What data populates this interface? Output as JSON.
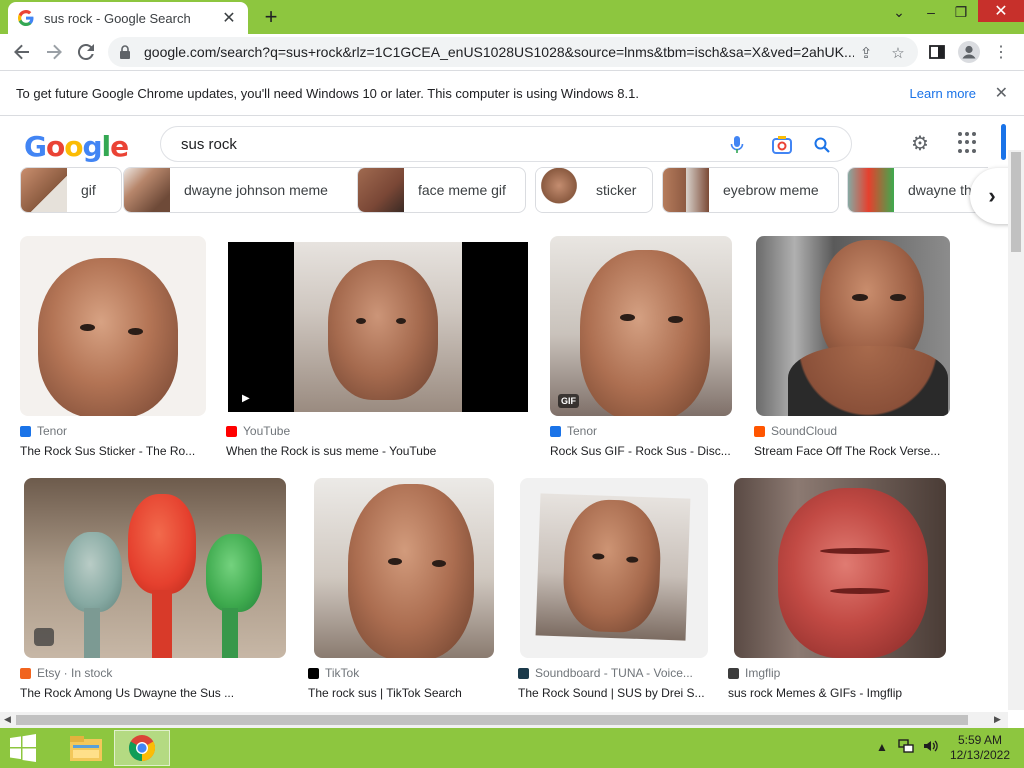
{
  "browser": {
    "tab_title": "sus rock - Google Search",
    "url": "google.com/search?q=sus+rock&rlz=1C1GCEA_enUS1028US1028&source=lnms&tbm=isch&sa=X&ved=2ahUK...",
    "favicon_letter": "G"
  },
  "infobar": {
    "message": "To get future Google Chrome updates, you'll need Windows 10 or later. This computer is using Windows 8.1.",
    "learn_more": "Learn more"
  },
  "search": {
    "query": "sus rock"
  },
  "chips": [
    {
      "label": "gif"
    },
    {
      "label": "dwayne johnson meme"
    },
    {
      "label": "face meme gif"
    },
    {
      "label": "sticker"
    },
    {
      "label": "eyebrow meme"
    },
    {
      "label": "dwayne th"
    }
  ],
  "results": [
    {
      "source": "Tenor",
      "title": "The Rock Sus Sticker - The Ro...",
      "source_color": "#1a73e8"
    },
    {
      "source": "YouTube",
      "title": "When the Rock is sus meme - YouTube",
      "source_color": "#ff0000"
    },
    {
      "source": "Tenor",
      "title": "Rock Sus GIF - Rock Sus - Disc...",
      "source_color": "#1a73e8",
      "badge": "GIF"
    },
    {
      "source": "SoundCloud",
      "title": "Stream Face Off The Rock Verse...",
      "source_color": "#ff5500"
    },
    {
      "source": "Etsy · In stock",
      "title": "The Rock Among Us Dwayne the Sus ...",
      "source_color": "#f1641e"
    },
    {
      "source": "TikTok",
      "title": "The rock sus | TikTok Search",
      "source_color": "#000000"
    },
    {
      "source": "Soundboard - TUNA - Voice...",
      "title": "The Rock Sound | SUS by Drei S...",
      "source_color": "#1b3a4b"
    },
    {
      "source": "Imgflip",
      "title": "sus rock Memes & GIFs - Imgflip",
      "source_color": "#3c3c3c"
    }
  ],
  "taskbar": {
    "time": "5:59 AM",
    "date": "12/13/2022"
  }
}
